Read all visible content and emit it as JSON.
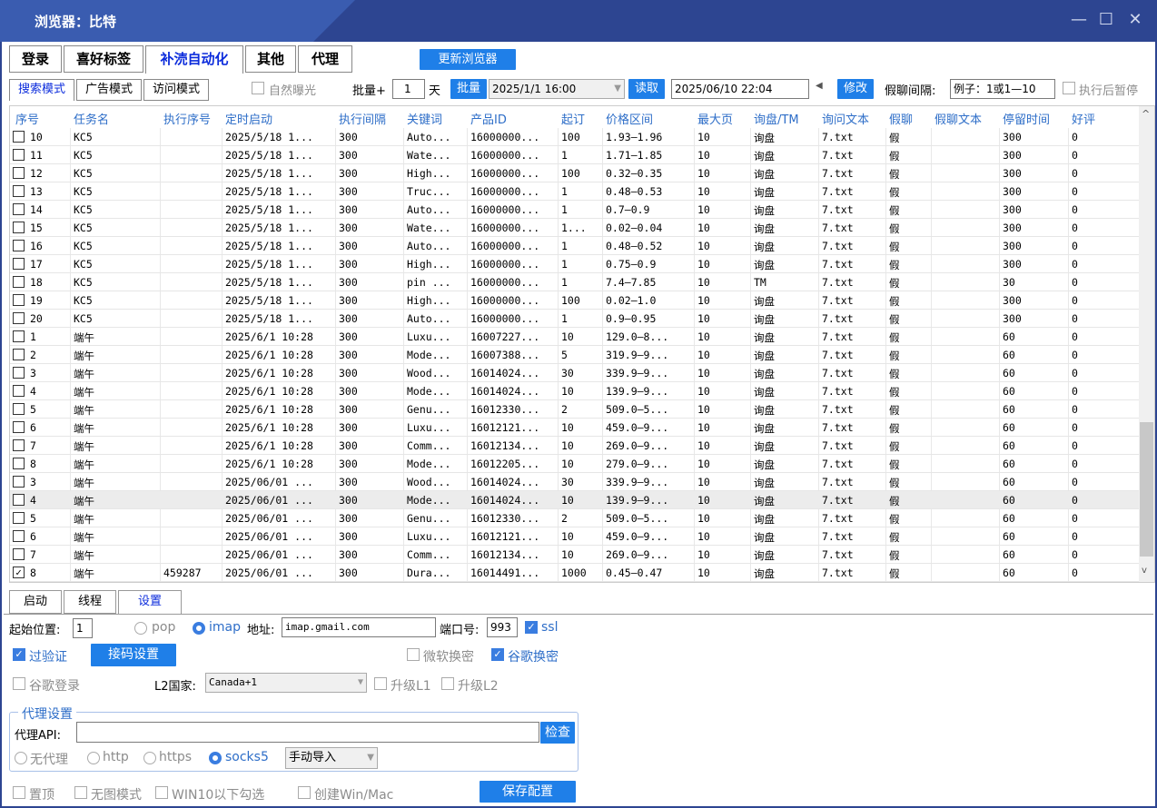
{
  "window": {
    "title": "浏览器：比特"
  },
  "main_tabs": [
    "登录",
    "喜好标签",
    "补涜自动化",
    "其他",
    "代理"
  ],
  "update_button": "更新浏览器",
  "sub_tabs": [
    "搜索模式",
    "广告模式",
    "访问模式"
  ],
  "toolbar": {
    "natural_exposure": "自然曝光",
    "batch_label": "批量+",
    "batch_value": "1",
    "day_label": "天",
    "batch_button": "批量",
    "date1": "2025/1/1 16:00",
    "read_button": "读取",
    "date2": "2025/06/10 22:04",
    "modify_button": "修改",
    "chat_interval_label": "假聊间隔:",
    "chat_interval_value": "例子：1或1—10",
    "pause_after": "执行后暂停"
  },
  "table": {
    "headers": [
      "序号",
      "任务名",
      "执行序号",
      "定时启动",
      "执行间隔",
      "关键词",
      "产品ID",
      "起订",
      "价格区间",
      "最大页",
      "询盘/TM",
      "询问文本",
      "假聊",
      "假聊文本",
      "停留时间",
      "好评"
    ],
    "rows": [
      [
        "10",
        "KC5",
        "",
        "2025/5/18 1...",
        "300",
        "Auto...",
        "16000000...",
        "100",
        "1.93—1.96",
        "10",
        "询盘",
        "7.txt",
        "假",
        "",
        "300",
        "0"
      ],
      [
        "11",
        "KC5",
        "",
        "2025/5/18 1...",
        "300",
        "Wate...",
        "16000000...",
        "1",
        "1.71—1.85",
        "10",
        "询盘",
        "7.txt",
        "假",
        "",
        "300",
        "0"
      ],
      [
        "12",
        "KC5",
        "",
        "2025/5/18 1...",
        "300",
        "High...",
        "16000000...",
        "100",
        "0.32—0.35",
        "10",
        "询盘",
        "7.txt",
        "假",
        "",
        "300",
        "0"
      ],
      [
        "13",
        "KC5",
        "",
        "2025/5/18 1...",
        "300",
        "Truc...",
        "16000000...",
        "1",
        "0.48—0.53",
        "10",
        "询盘",
        "7.txt",
        "假",
        "",
        "300",
        "0"
      ],
      [
        "14",
        "KC5",
        "",
        "2025/5/18 1...",
        "300",
        "Auto...",
        "16000000...",
        "1",
        "0.7—0.9",
        "10",
        "询盘",
        "7.txt",
        "假",
        "",
        "300",
        "0"
      ],
      [
        "15",
        "KC5",
        "",
        "2025/5/18 1...",
        "300",
        "Wate...",
        "16000000...",
        "1...",
        "0.02—0.04",
        "10",
        "询盘",
        "7.txt",
        "假",
        "",
        "300",
        "0"
      ],
      [
        "16",
        "KC5",
        "",
        "2025/5/18 1...",
        "300",
        "Auto...",
        "16000000...",
        "1",
        "0.48—0.52",
        "10",
        "询盘",
        "7.txt",
        "假",
        "",
        "300",
        "0"
      ],
      [
        "17",
        "KC5",
        "",
        "2025/5/18 1...",
        "300",
        "High...",
        "16000000...",
        "1",
        "0.75—0.9",
        "10",
        "询盘",
        "7.txt",
        "假",
        "",
        "300",
        "0"
      ],
      [
        "18",
        "KC5",
        "",
        "2025/5/18 1...",
        "300",
        "pin ...",
        "16000000...",
        "1",
        "7.4—7.85",
        "10",
        "TM",
        "7.txt",
        "假",
        "",
        "30",
        "0"
      ],
      [
        "19",
        "KC5",
        "",
        "2025/5/18 1...",
        "300",
        "High...",
        "16000000...",
        "100",
        "0.02—1.0",
        "10",
        "询盘",
        "7.txt",
        "假",
        "",
        "300",
        "0"
      ],
      [
        "20",
        "KC5",
        "",
        "2025/5/18 1...",
        "300",
        "Auto...",
        "16000000...",
        "1",
        "0.9—0.95",
        "10",
        "询盘",
        "7.txt",
        "假",
        "",
        "300",
        "0"
      ],
      [
        "1",
        "端午",
        "",
        "2025/6/1 10:28",
        "300",
        "Luxu...",
        "16007227...",
        "10",
        "129.0—8...",
        "10",
        "询盘",
        "7.txt",
        "假",
        "",
        "60",
        "0"
      ],
      [
        "2",
        "端午",
        "",
        "2025/6/1 10:28",
        "300",
        "Mode...",
        "16007388...",
        "5",
        "319.9—9...",
        "10",
        "询盘",
        "7.txt",
        "假",
        "",
        "60",
        "0"
      ],
      [
        "3",
        "端午",
        "",
        "2025/6/1 10:28",
        "300",
        "Wood...",
        "16014024...",
        "30",
        "339.9—9...",
        "10",
        "询盘",
        "7.txt",
        "假",
        "",
        "60",
        "0"
      ],
      [
        "4",
        "端午",
        "",
        "2025/6/1 10:28",
        "300",
        "Mode...",
        "16014024...",
        "10",
        "139.9—9...",
        "10",
        "询盘",
        "7.txt",
        "假",
        "",
        "60",
        "0"
      ],
      [
        "5",
        "端午",
        "",
        "2025/6/1 10:28",
        "300",
        "Genu...",
        "16012330...",
        "2",
        "509.0—5...",
        "10",
        "询盘",
        "7.txt",
        "假",
        "",
        "60",
        "0"
      ],
      [
        "6",
        "端午",
        "",
        "2025/6/1 10:28",
        "300",
        "Luxu...",
        "16012121...",
        "10",
        "459.0—9...",
        "10",
        "询盘",
        "7.txt",
        "假",
        "",
        "60",
        "0"
      ],
      [
        "7",
        "端午",
        "",
        "2025/6/1 10:28",
        "300",
        "Comm...",
        "16012134...",
        "10",
        "269.0—9...",
        "10",
        "询盘",
        "7.txt",
        "假",
        "",
        "60",
        "0"
      ],
      [
        "8",
        "端午",
        "",
        "2025/6/1 10:28",
        "300",
        "Mode...",
        "16012205...",
        "10",
        "279.0—9...",
        "10",
        "询盘",
        "7.txt",
        "假",
        "",
        "60",
        "0"
      ],
      [
        "3",
        "端午",
        "",
        "2025/06/01 ...",
        "300",
        "Wood...",
        "16014024...",
        "30",
        "339.9—9...",
        "10",
        "询盘",
        "7.txt",
        "假",
        "",
        "60",
        "0"
      ],
      [
        "4",
        "端午",
        "",
        "2025/06/01 ...",
        "300",
        "Mode...",
        "16014024...",
        "10",
        "139.9—9...",
        "10",
        "询盘",
        "7.txt",
        "假",
        "",
        "60",
        "0"
      ],
      [
        "5",
        "端午",
        "",
        "2025/06/01 ...",
        "300",
        "Genu...",
        "16012330...",
        "2",
        "509.0—5...",
        "10",
        "询盘",
        "7.txt",
        "假",
        "",
        "60",
        "0"
      ],
      [
        "6",
        "端午",
        "",
        "2025/06/01 ...",
        "300",
        "Luxu...",
        "16012121...",
        "10",
        "459.0—9...",
        "10",
        "询盘",
        "7.txt",
        "假",
        "",
        "60",
        "0"
      ],
      [
        "7",
        "端午",
        "",
        "2025/06/01 ...",
        "300",
        "Comm...",
        "16012134...",
        "10",
        "269.0—9...",
        "10",
        "询盘",
        "7.txt",
        "假",
        "",
        "60",
        "0"
      ],
      [
        "8",
        "端午",
        "459287",
        "2025/06/01 ...",
        "300",
        "Dura...",
        "16014491...",
        "1000",
        "0.45—0.47",
        "10",
        "询盘",
        "7.txt",
        "假",
        "",
        "60",
        "0"
      ]
    ],
    "checked_row": 24,
    "selected_row": 20
  },
  "bottom_tabs": [
    "启动",
    "线程",
    "设置"
  ],
  "settings": {
    "start_pos_label": "起始位置:",
    "start_pos_value": "1",
    "pop": "pop",
    "imap": "imap",
    "addr_label": "地址:",
    "addr_value": "imap.gmail.com",
    "port_label": "端口号:",
    "port_value": "993",
    "ssl": "ssl",
    "verify": "过验证",
    "code_button": "接码设置",
    "ms_change": "微软换密",
    "google_change": "谷歌换密",
    "google_login": "谷歌登录",
    "l2_label": "L2国家:",
    "l2_value": "Canada+1",
    "upgrade_l1": "升级L1",
    "upgrade_l2": "升级L2",
    "proxy_legend": "代理设置",
    "proxy_api_label": "代理API:",
    "check_button": "检查",
    "no_proxy": "无代理",
    "http": "http",
    "https": "https",
    "socks5": "socks5",
    "import_mode": "手动导入",
    "top": "置顶",
    "no_image": "无图模式",
    "win10": "WIN10以下勾选",
    "create_win": "创建Win/Mac",
    "save_button": "保存配置"
  },
  "window_controls": {
    "minimize": "—",
    "maximize": "☐",
    "close": "✕"
  }
}
